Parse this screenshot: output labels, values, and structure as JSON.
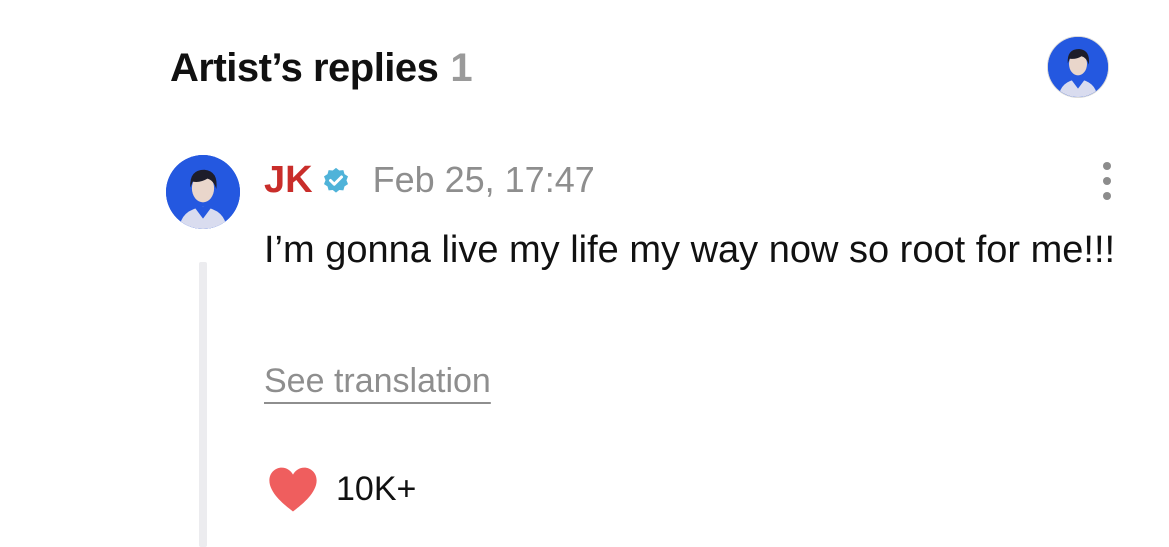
{
  "header": {
    "title": "Artist’s replies",
    "count": "1",
    "avatar_icon": "profile-avatar"
  },
  "post": {
    "author": "JK",
    "verified_icon": "verified-badge-icon",
    "date": "Feb 25, 17:47",
    "body": "I’m gonna live my life my way now so root for me!!!",
    "translation_link": "See translation",
    "likes": "10K+",
    "like_icon": "heart-icon",
    "more_icon": "more-vertical-icon"
  },
  "colors": {
    "author_name": "#c92d2a",
    "verified_badge": "#4fb3d9",
    "heart": "#ef5e5e",
    "muted_text": "#8e8e8e",
    "avatar_background": "#2458e0"
  }
}
